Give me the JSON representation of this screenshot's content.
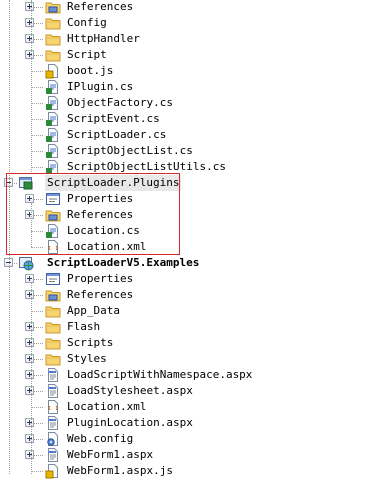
{
  "highlight_color": "#d42a2a",
  "tree": [
    {
      "label": "References",
      "icon": "references-icon",
      "expander": "plus",
      "bold": false
    },
    {
      "label": "Config",
      "icon": "folder-icon",
      "expander": "plus",
      "bold": false
    },
    {
      "label": "HttpHandler",
      "icon": "folder-icon",
      "expander": "plus",
      "bold": false
    },
    {
      "label": "Script",
      "icon": "folder-icon",
      "expander": "plus",
      "bold": false
    },
    {
      "label": "boot.js",
      "icon": "js-file-icon",
      "expander": "none",
      "bold": false
    },
    {
      "label": "IPlugin.cs",
      "icon": "cs-file-icon",
      "expander": "none",
      "bold": false
    },
    {
      "label": "ObjectFactory.cs",
      "icon": "cs-file-icon",
      "expander": "none",
      "bold": false
    },
    {
      "label": "ScriptEvent.cs",
      "icon": "cs-file-icon",
      "expander": "none",
      "bold": false
    },
    {
      "label": "ScriptLoader.cs",
      "icon": "cs-file-icon",
      "expander": "none",
      "bold": false
    },
    {
      "label": "ScriptObjectList.cs",
      "icon": "cs-file-icon",
      "expander": "none",
      "bold": false
    },
    {
      "label": "ScriptObjectListUtils.cs",
      "icon": "cs-file-icon",
      "expander": "none",
      "bold": false
    },
    {
      "label": "ScriptLoader.Plugins",
      "icon": "csharp-project-icon",
      "expander": "minus",
      "bold": false,
      "selected": true
    },
    {
      "label": "Properties",
      "icon": "properties-icon",
      "expander": "plus",
      "bold": false
    },
    {
      "label": "References",
      "icon": "references-icon",
      "expander": "plus",
      "bold": false
    },
    {
      "label": "Location.cs",
      "icon": "cs-file-icon",
      "expander": "none",
      "bold": false
    },
    {
      "label": "Location.xml",
      "icon": "xml-file-icon",
      "expander": "none",
      "bold": false
    },
    {
      "label": "ScriptLoaderV5.Examples",
      "icon": "web-project-icon",
      "expander": "minus",
      "bold": true
    },
    {
      "label": "Properties",
      "icon": "properties-icon",
      "expander": "plus",
      "bold": false
    },
    {
      "label": "References",
      "icon": "references-icon",
      "expander": "plus",
      "bold": false
    },
    {
      "label": "App_Data",
      "icon": "folder-icon",
      "expander": "none",
      "bold": false
    },
    {
      "label": "Flash",
      "icon": "folder-icon",
      "expander": "plus",
      "bold": false
    },
    {
      "label": "Scripts",
      "icon": "folder-icon",
      "expander": "plus",
      "bold": false
    },
    {
      "label": "Styles",
      "icon": "folder-icon",
      "expander": "plus",
      "bold": false
    },
    {
      "label": "LoadScriptWithNamespace.aspx",
      "icon": "aspx-file-icon",
      "expander": "plus",
      "bold": false
    },
    {
      "label": "LoadStylesheet.aspx",
      "icon": "aspx-file-icon",
      "expander": "plus",
      "bold": false
    },
    {
      "label": "Location.xml",
      "icon": "xml-file-icon",
      "expander": "none",
      "bold": false
    },
    {
      "label": "PluginLocation.aspx",
      "icon": "aspx-file-icon",
      "expander": "plus",
      "bold": false
    },
    {
      "label": "Web.config",
      "icon": "config-file-icon",
      "expander": "plus",
      "bold": false
    },
    {
      "label": "WebForm1.aspx",
      "icon": "aspx-file-icon",
      "expander": "plus",
      "bold": false
    },
    {
      "label": "WebForm1.aspx.js",
      "icon": "js-file-icon",
      "expander": "none",
      "bold": false
    }
  ]
}
